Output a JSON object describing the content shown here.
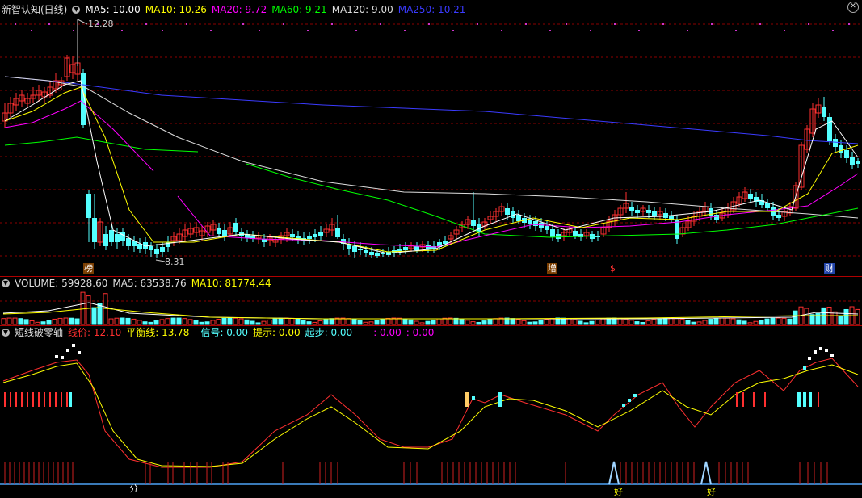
{
  "main_panel": {
    "stock_name": "新智认知(日线)",
    "ma_legend": [
      {
        "label": "MA5: 10.00",
        "color": "#ffffff"
      },
      {
        "label": "MA10: 10.26",
        "color": "#ffff00"
      },
      {
        "label": "MA20: 9.72",
        "color": "#ff00ff"
      },
      {
        "label": "MA60: 9.21",
        "color": "#00ff00"
      },
      {
        "label": "MA120: 9.00",
        "color": "#dddddd"
      },
      {
        "label": "MA250: 10.21",
        "color": "#3b3bff"
      }
    ],
    "high_label": "12.28",
    "low_label": "8.31",
    "event_markers": [
      {
        "text": "榜",
        "color": "#ffffff",
        "bg": "#7a3d00"
      },
      {
        "text": "增",
        "color": "#ffffff",
        "bg": "#7a3d00"
      },
      {
        "text": "$",
        "color": "#ff3030",
        "bg": "transparent"
      },
      {
        "text": "财",
        "color": "#ffffff",
        "bg": "#2244aa"
      }
    ]
  },
  "volume_panel": {
    "title": "VOLUME: 59928.60",
    "ma5": "MA5: 63538.76",
    "ma10": "MA10: 81774.44"
  },
  "indicator_panel": {
    "name": "短线破零轴",
    "line_price": "线价: 12.10",
    "balance_line": "平衡线: 13.78",
    "signal": "信号: 0.00",
    "hint": "提示: 0.00",
    "start": "起步: 0.00",
    "extra1": ": 0.00",
    "extra2": ": 0.00",
    "bottom_tags": [
      {
        "text": "分",
        "color": "#ffffff"
      },
      {
        "text": "好",
        "color": "#ffff00"
      },
      {
        "text": "好",
        "color": "#ffff00"
      }
    ]
  },
  "colors": {
    "up": "#ff3030",
    "down": "#54ffff",
    "grid": "#8b0000",
    "background": "#000000"
  },
  "icons": {
    "collapse": "chevron-down-icon",
    "close": "close-icon"
  }
}
